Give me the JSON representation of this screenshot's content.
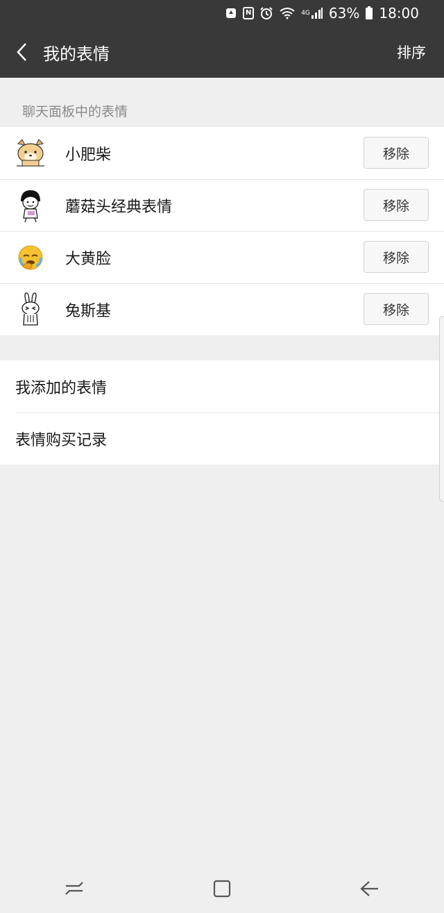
{
  "status_bar": {
    "battery": "63%",
    "time": "18:00",
    "network": "4G",
    "icons": [
      "recycle-icon",
      "nfc-icon",
      "alarm-icon",
      "wifi-icon",
      "signal-icon",
      "battery-icon"
    ]
  },
  "nav": {
    "title": "我的表情",
    "sort_label": "排序",
    "back_icon": "chevron-left-icon"
  },
  "section": {
    "header": "聊天面板中的表情"
  },
  "sticker_list": [
    {
      "name": "小肥柴",
      "remove_label": "移除",
      "thumb": "shiba-dog-icon"
    },
    {
      "name": "蘑菇头经典表情",
      "remove_label": "移除",
      "thumb": "mushroom-head-icon"
    },
    {
      "name": "大黄脸",
      "remove_label": "移除",
      "thumb": "yellow-face-icon"
    },
    {
      "name": "兔斯基",
      "remove_label": "移除",
      "thumb": "tuzki-icon"
    }
  ],
  "links": [
    {
      "label": "我添加的表情"
    },
    {
      "label": "表情购买记录"
    }
  ],
  "colors": {
    "header_bg": "#393939",
    "page_bg": "#efefef",
    "row_bg": "#ffffff",
    "button_bg": "#f7f7f7"
  },
  "system_nav": [
    "recent-apps-icon",
    "home-icon",
    "back-arrow-icon"
  ]
}
